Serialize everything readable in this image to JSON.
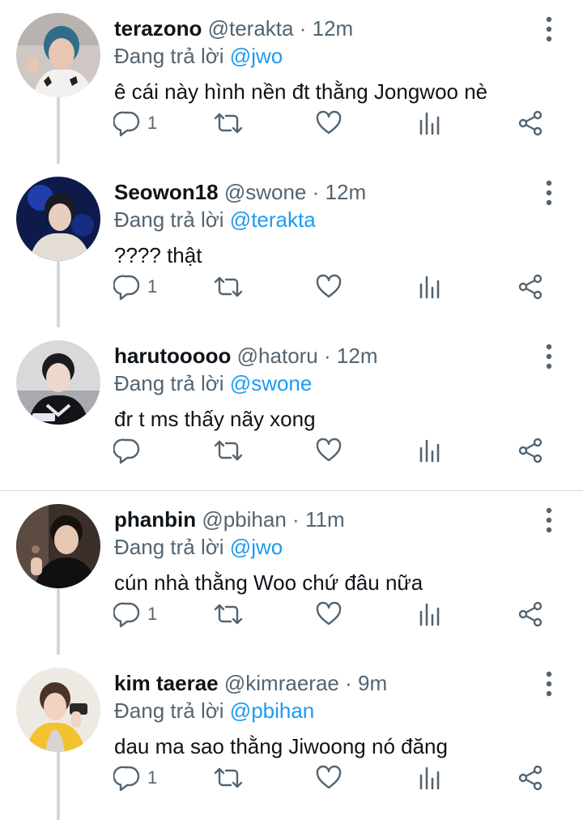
{
  "colors": {
    "accent": "#1d9bf0",
    "muted": "#536471",
    "text": "#0f1419",
    "thread_line": "#cfd9de"
  },
  "tweets": [
    {
      "name": "terazono",
      "handle": "@terakta",
      "sep": "·",
      "time": "12m",
      "reply_prefix": "Đang trả lời",
      "reply_to": "@jwo",
      "text": "ê cái này hình nền đt thằng Jongwoo nè",
      "reply_count": "1",
      "avatar": "avatar-photo"
    },
    {
      "name": "Seowon18",
      "handle": "@swone",
      "sep": "·",
      "time": "12m",
      "reply_prefix": "Đang trả lời",
      "reply_to": "@terakta",
      "text": "???? thật",
      "reply_count": "1",
      "avatar": "avatar-photo"
    },
    {
      "name": "harutooooo",
      "handle": "@hatoru",
      "sep": "·",
      "time": "12m",
      "reply_prefix": "Đang trả lời",
      "reply_to": "@swone",
      "text": "đr t ms thấy nãy xong",
      "reply_count": "",
      "avatar": "avatar-photo"
    },
    {
      "name": "phanbin",
      "handle": "@pbihan",
      "sep": "·",
      "time": "11m",
      "reply_prefix": "Đang trả lời",
      "reply_to": "@jwo",
      "text": "cún nhà thằng Woo chứ đâu nữa",
      "reply_count": "1",
      "avatar": "avatar-photo"
    },
    {
      "name": "kim taerae",
      "handle": "@kimraerae",
      "sep": "·",
      "time": "9m",
      "reply_prefix": "Đang trả lời",
      "reply_to": "@pbihan",
      "text": "dau ma sao thằng Jiwoong nó đăng",
      "reply_count": "1",
      "avatar": "avatar-photo"
    }
  ]
}
